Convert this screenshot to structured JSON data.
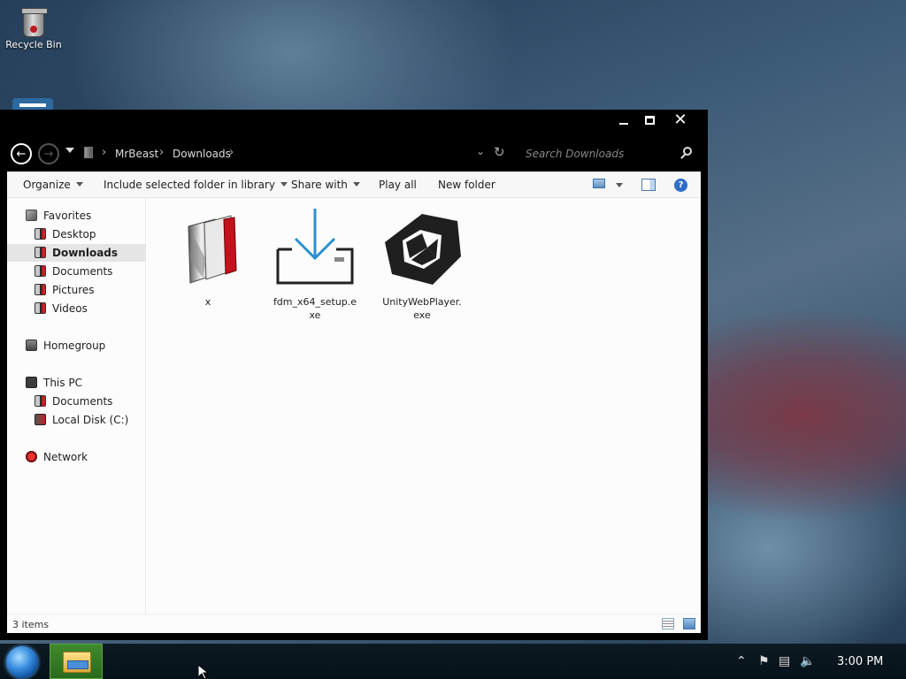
{
  "desktop": {
    "icons": [
      {
        "label": "Recycle Bin",
        "icon": "recycle-bin-icon"
      }
    ]
  },
  "window": {
    "caption": {
      "minimize": "minimize",
      "maximize": "maximize",
      "close": "✕"
    },
    "address": {
      "breadcrumbs": [
        "MrBeast",
        "Downloads"
      ],
      "search_placeholder": "Search Downloads"
    },
    "toolbar": {
      "organize": "Organize",
      "include_in_library": "Include selected folder in library",
      "share_with": "Share with",
      "play_all": "Play all",
      "new_folder": "New folder",
      "help": "?"
    },
    "nav": {
      "favorites": "Favorites",
      "desktop": "Desktop",
      "downloads": "Downloads",
      "documents": "Documents",
      "pictures": "Pictures",
      "videos": "Videos",
      "homegroup": "Homegroup",
      "this_pc": "This PC",
      "pc_documents": "Documents",
      "local_disk": "Local Disk (C:)",
      "network": "Network"
    },
    "selected_nav": "Downloads",
    "files": [
      {
        "name": "x",
        "icon": "folder-app-icon"
      },
      {
        "name": "fdm_x64_setup.exe",
        "icon": "download-installer-icon"
      },
      {
        "name": "UnityWebPlayer.exe",
        "icon": "unity-icon"
      }
    ],
    "status": {
      "item_count": "3 items"
    }
  },
  "taskbar": {
    "clock": "3:00 PM",
    "tray_icons": [
      "show-hidden-icons-icon",
      "action-center-flag-icon",
      "network-icon",
      "volume-icon"
    ],
    "pinned": [
      "file-explorer-icon"
    ]
  }
}
